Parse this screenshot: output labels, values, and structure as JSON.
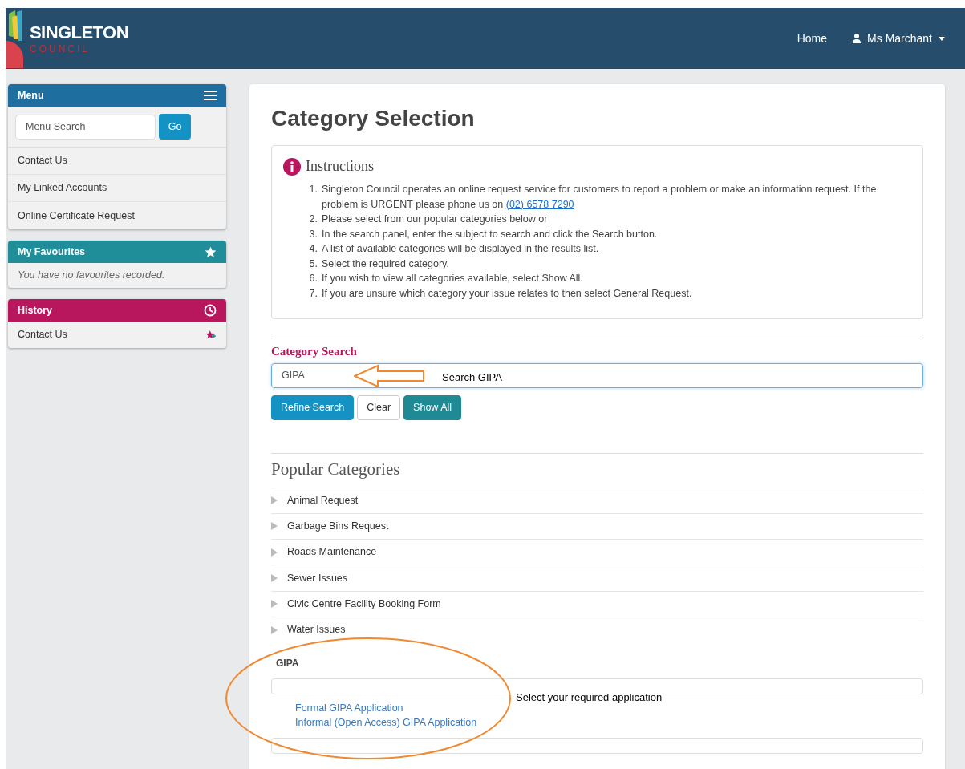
{
  "header": {
    "logo": {
      "name": "SINGLETON",
      "sub": "COUNCIL"
    },
    "nav": [
      {
        "label": "Home",
        "kind": "link"
      },
      {
        "label": "Ms Marchant",
        "kind": "user"
      }
    ]
  },
  "sidebar": {
    "menu": {
      "title": "Menu",
      "search_placeholder": "Menu Search",
      "go": "Go",
      "items": [
        "Contact Us",
        "My Linked Accounts",
        "Online Certificate Request"
      ]
    },
    "favourites": {
      "title": "My Favourites",
      "empty": "You have no favourites recorded."
    },
    "history": {
      "title": "History",
      "items": [
        "Contact Us"
      ]
    }
  },
  "main": {
    "title": "Category Selection",
    "instructions": {
      "title": "Instructions",
      "items": [
        {
          "number": "1.",
          "text": "Singleton Council operates an online request service for customers to report a problem or make an information request. If the problem is URGENT please phone us on ",
          "link": "(02) 6578 7290"
        },
        {
          "number": "2.",
          "text": "Please select from our popular categories below or"
        },
        {
          "number": "3.",
          "text": "In the search panel, enter the subject to search and click the Search button."
        },
        {
          "number": "4.",
          "text": "A list of available categories will be displayed in the results list."
        },
        {
          "number": "5.",
          "text": "Select the required category."
        },
        {
          "number": "6.",
          "text": "If you wish to view all categories available, select Show All."
        },
        {
          "number": "7.",
          "text": "If you are unsure which category your issue relates to then select General Request."
        }
      ]
    },
    "category_search": {
      "title": "Category Search",
      "value": "GIPA",
      "buttons": [
        {
          "label": "Refine Search",
          "kind": "primary"
        },
        {
          "label": "Clear",
          "kind": "default"
        },
        {
          "label": "Show All",
          "kind": "teal"
        }
      ]
    },
    "popular": {
      "title": "Popular Categories",
      "items": [
        "Animal Request",
        "Garbage Bins Request",
        "Roads Maintenance",
        "Sewer Issues",
        "Civic Centre Facility Booking Form",
        "Water Issues"
      ]
    },
    "results": {
      "title": "GIPA",
      "links": [
        "Formal GIPA Application",
        "Informal (Open Access) GIPA Application"
      ]
    }
  },
  "annotations": {
    "search_note": "Search GIPA",
    "select_note": "Select your required application"
  }
}
